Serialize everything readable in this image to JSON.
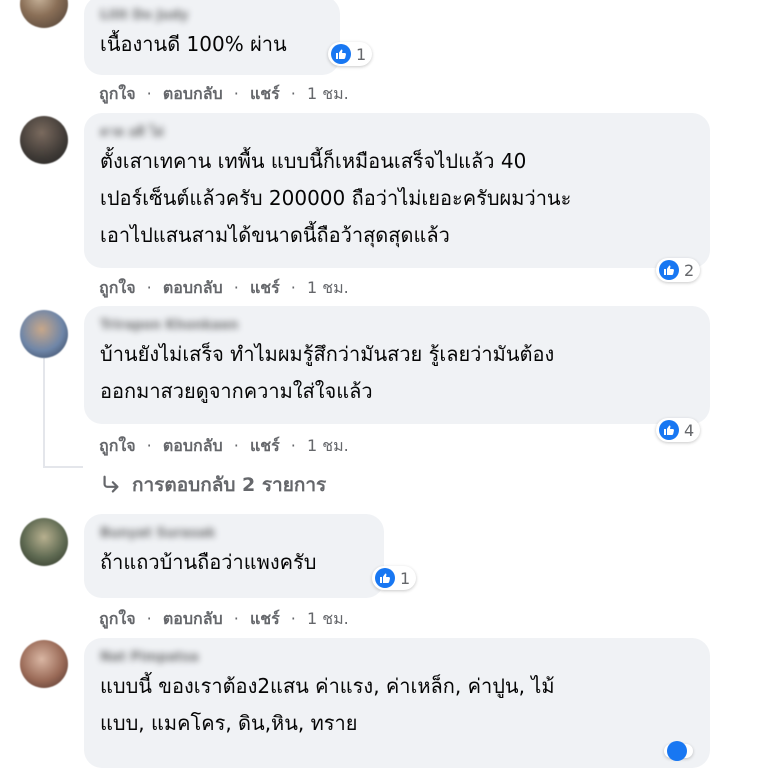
{
  "actions": {
    "like": "ถูกใจ",
    "reply": "ตอบกลับ",
    "share": "แชร์",
    "dot": "·"
  },
  "comments": [
    {
      "author": "Lilit Do Judy",
      "text": "เนื้องานดี 100% ผ่าน",
      "reactions": "1",
      "time": "1 ชม."
    },
    {
      "author": "ดาด อดิ ไผ่",
      "text": "ตั้งเสาเทคาน เทพื้น แบบนี้ก็เหมือนเสร็จไปแล้ว 40\nเปอร์เซ็นต์แล้วครับ 200000 ถือว่าไม่เยอะครับผมว่านะ\nเอาไปแสนสามได้ขนาดนี้ถือว้าสุดสุดแล้ว",
      "reactions": "2",
      "time": "1 ชม."
    },
    {
      "author": "Trirapon Khonkaen",
      "text": "บ้านยังไม่เสร็จ ทำไมผมรู้สึกว่ามันสวย รู้เลยว่ามันต้อง\nออกมาสวยดูจากความใส่ใจแล้ว",
      "reactions": "4",
      "time": "1 ชม."
    },
    {
      "author": "Bunyat Surasak",
      "text": "ถ้าแถวบ้านถือว่าแพงครับ",
      "reactions": "1",
      "time": "1 ชม."
    },
    {
      "author": "Nat Pimpatsa",
      "text": "แบบนี้ ของเราต้อง2แสน ค่าแรง, ค่าเหล็ก, ค่าปูน, ไม้\nแบบ, แมคโคร, ดิน,หิน, ทราย",
      "reactions": "",
      "time": ""
    }
  ],
  "replies_label": "การตอบกลับ 2 รายการ",
  "colors": {
    "bubble": "#f0f2f5",
    "muted": "#65676b",
    "like": "#1877f2"
  },
  "icons": [
    "like-icon",
    "reply-arrow-icon",
    "avatar"
  ]
}
